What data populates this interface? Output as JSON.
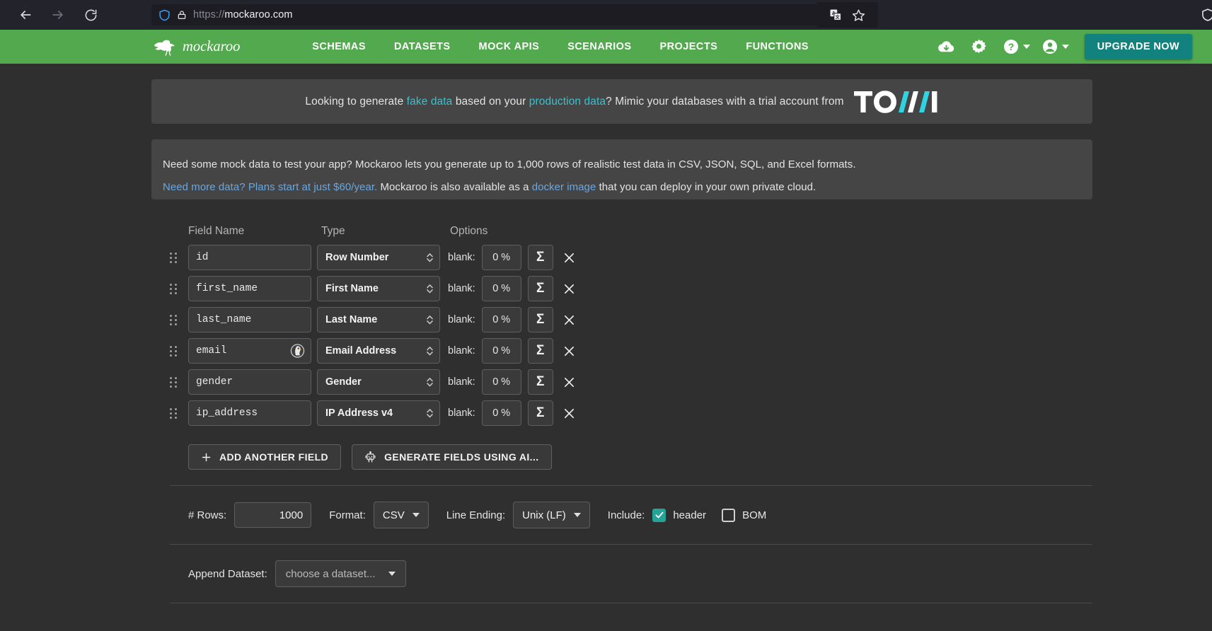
{
  "browser": {
    "back_icon": "arrow-left-icon",
    "forward_icon": "arrow-right-icon",
    "reload_icon": "reload-icon",
    "shield_icon": "ddg-shield-icon",
    "lock_icon": "lock-icon",
    "url_scheme": "https://",
    "url_host": "mockaroo.com",
    "url_full": "https://mockaroo.com",
    "translate_icon": "translate-icon",
    "bookmark_icon": "star-icon",
    "edge_shield_icon": "shield-icon"
  },
  "navbar": {
    "brand": "mockaroo",
    "links": [
      {
        "label": "SCHEMAS"
      },
      {
        "label": "DATASETS"
      },
      {
        "label": "MOCK APIS"
      },
      {
        "label": "SCENARIOS"
      },
      {
        "label": "PROJECTS"
      },
      {
        "label": "FUNCTIONS"
      }
    ],
    "icons": [
      {
        "name": "cloud-download-icon"
      },
      {
        "name": "gear-icon"
      },
      {
        "name": "help-icon",
        "caret": true
      },
      {
        "name": "account-icon",
        "caret": true
      }
    ],
    "upgrade_label": "UPGRADE NOW",
    "green": "#53a94d",
    "upgrade_color": "#12827e"
  },
  "promo": {
    "part1": "Looking to generate ",
    "link1": "fake data",
    "part2": " based on your ",
    "link2": "production data",
    "part3": "? Mimic your databases with a trial account from ",
    "logo": "TONIC",
    "link_color": "#37c2d0"
  },
  "info": {
    "line1": "Need some mock data to test your app? Mockaroo lets you generate up to 1,000 rows of realistic test data in CSV, JSON, SQL, and Excel formats.",
    "line2_link1": "Need more data? Plans start at just $60/year.",
    "line2_mid": " Mockaroo is also available as a ",
    "line2_link2": "docker image",
    "line2_end": " that you can deploy in your own private cloud.",
    "link_color": "#6aa6e0"
  },
  "table": {
    "headers": {
      "field_name": "Field Name",
      "type": "Type",
      "options": "Options"
    },
    "blank_label": "blank:",
    "sigma_glyph": "Σ",
    "delete_glyph": "✕",
    "rows": [
      {
        "name": "id",
        "type": "Row Number",
        "blank": "0 %",
        "badge": null
      },
      {
        "name": "first_name",
        "type": "First Name",
        "blank": "0 %",
        "badge": null
      },
      {
        "name": "last_name",
        "type": "Last Name",
        "blank": "0 %",
        "badge": null
      },
      {
        "name": "email",
        "type": "Email Address",
        "blank": "0 %",
        "badge": "ddg-email-protection-icon"
      },
      {
        "name": "gender",
        "type": "Gender",
        "blank": "0 %",
        "badge": null
      },
      {
        "name": "ip_address",
        "type": "IP Address v4",
        "blank": "0 %",
        "badge": null
      }
    ]
  },
  "actions": {
    "add_field": "ADD ANOTHER FIELD",
    "add_icon": "plus-icon",
    "generate_ai": "GENERATE FIELDS USING AI...",
    "ai_icon": "robot-icon"
  },
  "options": {
    "rows_label": "# Rows:",
    "rows_value": "1000",
    "format_label": "Format:",
    "format_value": "CSV",
    "line_ending_label": "Line Ending:",
    "line_ending_value": "Unix (LF)",
    "include_label": "Include:",
    "header_label": "header",
    "header_checked": true,
    "bom_label": "BOM",
    "bom_checked": false,
    "checkbox_color": "#24a398"
  },
  "append": {
    "label": "Append Dataset:",
    "placeholder": "choose a dataset..."
  }
}
